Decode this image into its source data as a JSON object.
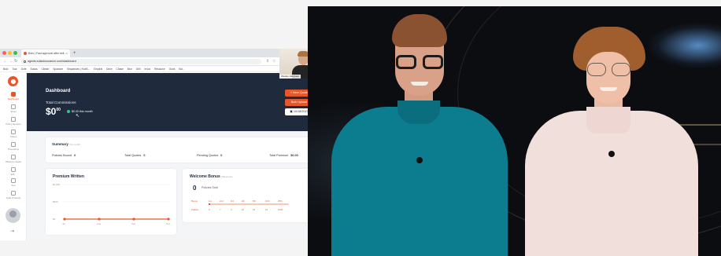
{
  "browser": {
    "tab_title": "Bolo | Fast approval after sell...",
    "url": "agents.solaninsurance.com/dashboard",
    "bookmarks": [
      "Bolo",
      "Tour",
      "Gofe",
      "Sodas",
      "Clintch",
      "Spaxtore",
      "Sequences | HubS...",
      "Empiral",
      "Drive",
      "Chase",
      "Bror",
      "Grill",
      "Irviox",
      "Resource",
      "Gova",
      "Bol..."
    ]
  },
  "sidebar": {
    "items": [
      {
        "label": "Dashboard",
        "icon": "grid-icon"
      },
      {
        "label": "Quote",
        "icon": "pencil-icon"
      },
      {
        "label": "Policy Services",
        "icon": "building-icon"
      },
      {
        "label": "Claims",
        "icon": "umbrella-icon"
      },
      {
        "label": "Promotions",
        "icon": "clock-icon"
      },
      {
        "label": "Welcome Guide",
        "icon": "book-icon"
      },
      {
        "label": "Self...",
        "icon": "user-icon"
      },
      {
        "label": "Tour",
        "icon": "flag-icon"
      },
      {
        "label": "Solar Products",
        "icon": "sun-icon"
      }
    ],
    "logout_icon": "logout-icon"
  },
  "header": {
    "title": "Dashboard",
    "commission_label": "Total Commissions",
    "commission_amount": "$0",
    "commission_cents": "00",
    "this_month": "$0.00  this month",
    "new_quote": "+ New Quote",
    "bulk_upload": "Bulk Upload",
    "date": "10/18/2023"
  },
  "summary": {
    "title": "Summary",
    "note": "this month",
    "stats": [
      {
        "label": "Policies Bound",
        "value": "0"
      },
      {
        "label": "Total Quotes",
        "value": "0"
      },
      {
        "label": "Pending Quotes",
        "value": "0"
      },
      {
        "label": "Total Premium",
        "value": "$0.00"
      }
    ]
  },
  "premium": {
    "title": "Premium Written",
    "y_ticks": [
      "$1,000",
      "$500",
      "$0"
    ],
    "x_ticks": [
      "Jul",
      "Aug",
      "Sep",
      "Oct"
    ]
  },
  "bonus": {
    "title": "Welcome Bonus",
    "note": "Milestones",
    "count": "0",
    "unit": "Policies Sold",
    "headers": [
      "Bonus",
      "1st",
      "2nd",
      "3rd",
      "4th",
      "5th",
      "10th",
      "25th"
    ],
    "values": [
      "Policies",
      "5",
      "7",
      "9",
      "10",
      "15",
      "15",
      "1000"
    ]
  },
  "pip": {
    "name": "Wesley Hargrave"
  },
  "colors": {
    "accent": "#e8572a",
    "header_bg": "#1f2a3d",
    "success": "#30c38f"
  }
}
